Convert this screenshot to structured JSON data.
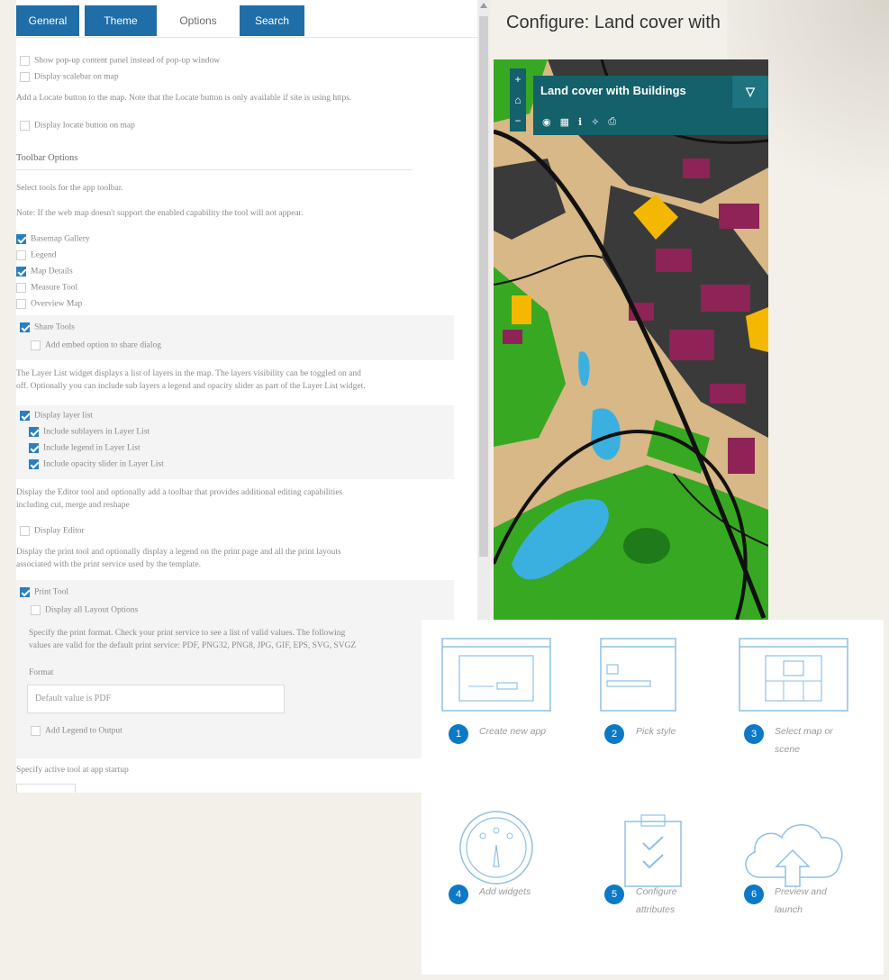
{
  "tabs": [
    {
      "label": "General",
      "active": false
    },
    {
      "label": "Theme",
      "active": false
    },
    {
      "label": "Options",
      "active": true
    },
    {
      "label": "Search",
      "active": false
    }
  ],
  "options": {
    "popup": "Show pop-up content panel instead of pop-up window",
    "scalebar": "Display scalebar on map",
    "locate_note": "Add a Locate button to the map. Note that the Locate button is only available if site is using https.",
    "locate": "Display locate button on map",
    "toolbar_heading": "Toolbar Options",
    "toolbar_desc": "Select tools for the app toolbar.",
    "toolbar_note": "Note: If the web map doesn't support the enabled capability the tool will not appear.",
    "basemap": "Basemap Gallery",
    "legend": "Legend",
    "map_details": "Map Details",
    "measure": "Measure Tool",
    "overview": "Overview Map",
    "share": "Share Tools",
    "embed": "Add embed option to share dialog",
    "layer_desc_1": "The Layer List widget displays a list of layers in the map. The layers visibility can be toggled on and",
    "layer_desc_2": "off. Optionally you can include sub layers a legend and opacity slider as part of the Layer List widget.",
    "layer_list": "Display layer list",
    "sublayers": "Include sublayers in Layer List",
    "layer_legend": "Include legend in Layer List",
    "opacity": "Include opacity slider in Layer List",
    "editor_desc_1": "Display the Editor tool and optionally add a toolbar that provides additional editing capabilities",
    "editor_desc_2": "including cut, merge and reshape",
    "editor": "Display Editor",
    "print_desc_1": "Display the print tool and optionally display a legend on the print page and all the print layouts",
    "print_desc_2": "associated with the print service used by the template.",
    "print_tool": "Print Tool",
    "layouts": "Display all Layout Options",
    "format_desc_1": "Specify the print format. Check your print service to see a list of valid values. The following",
    "format_desc_2": "values are valid for the default print service: PDF, PNG32, PNG8, JPG, GIF, EPS, SVG, SVGZ",
    "format_label": "Format",
    "format_placeholder": "Default value is PDF",
    "legend_output": "Add Legend to Output",
    "active_tool": "Specify active tool at app startup"
  },
  "checked": {
    "popup": false,
    "scalebar": false,
    "locate": false,
    "basemap": true,
    "legend": false,
    "map_details": true,
    "measure": false,
    "overview": false,
    "share": true,
    "embed": false,
    "layer_list": true,
    "sublayers": true,
    "layer_legend": true,
    "opacity": true,
    "editor": false,
    "print_tool": true,
    "layouts": false,
    "legend_output": false
  },
  "preview": {
    "title": "Configure: Land cover with",
    "map_title": "Land cover with Buildings"
  },
  "steps": [
    {
      "num": "1",
      "label": "Create new app",
      "icon": "create-app-icon"
    },
    {
      "num": "2",
      "label": "Pick style",
      "icon": "pick-style-icon"
    },
    {
      "num": "3",
      "label": "Select map or scene",
      "icon": "select-map-icon"
    },
    {
      "num": "4",
      "label": "Add widgets",
      "icon": "widgets-gauge-icon"
    },
    {
      "num": "5",
      "label": "Configure attributes",
      "icon": "clipboard-checklist-icon"
    },
    {
      "num": "6",
      "label": "Preview and launch",
      "icon": "cloud-upload-icon"
    }
  ],
  "colors": {
    "accent": "#1f6ea8",
    "badge": "#0b79c6",
    "map_header": "#14606b",
    "building": "#8e2357",
    "highlight": "#f5b800",
    "water": "#3ab0e0",
    "vegetation": "#37a822"
  }
}
